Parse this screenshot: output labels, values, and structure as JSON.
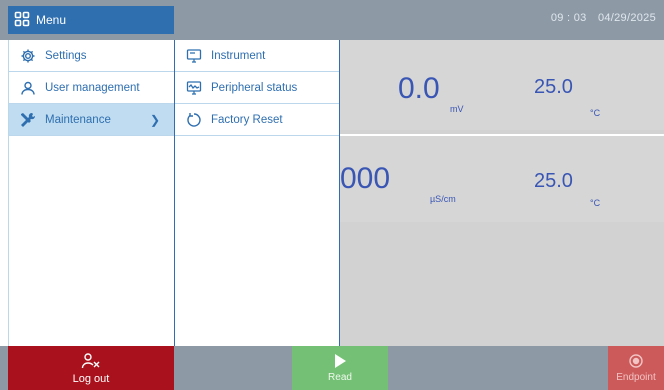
{
  "header": {
    "menu_title": "Menu",
    "time": "09 : 03",
    "date": "04/29/2025"
  },
  "menu": {
    "items": [
      {
        "label": "Settings",
        "icon": "gear-icon"
      },
      {
        "label": "User management",
        "icon": "user-icon"
      },
      {
        "label": "Maintenance",
        "icon": "tools-icon",
        "active": true
      }
    ],
    "submenu": [
      {
        "label": "Instrument",
        "icon": "monitor-icon"
      },
      {
        "label": "Peripheral status",
        "icon": "waveform-monitor-icon"
      },
      {
        "label": "Factory Reset",
        "icon": "reset-icon"
      }
    ]
  },
  "measurements": [
    {
      "value": "0.0",
      "unit": "mV",
      "temp": "25.0",
      "temp_unit": "°C"
    },
    {
      "value": "000",
      "unit": "µS/cm",
      "temp": "25.0",
      "temp_unit": "°C"
    }
  ],
  "footer": {
    "logout_label": "Log out",
    "read_label": "Read",
    "endpoint_label": "Endpoint"
  },
  "colors": {
    "accent": "#2f6fb0",
    "logout": "#a9121c",
    "read": "#74c074",
    "endpoint": "#cc5a5a",
    "value_text": "#3a56b4"
  }
}
